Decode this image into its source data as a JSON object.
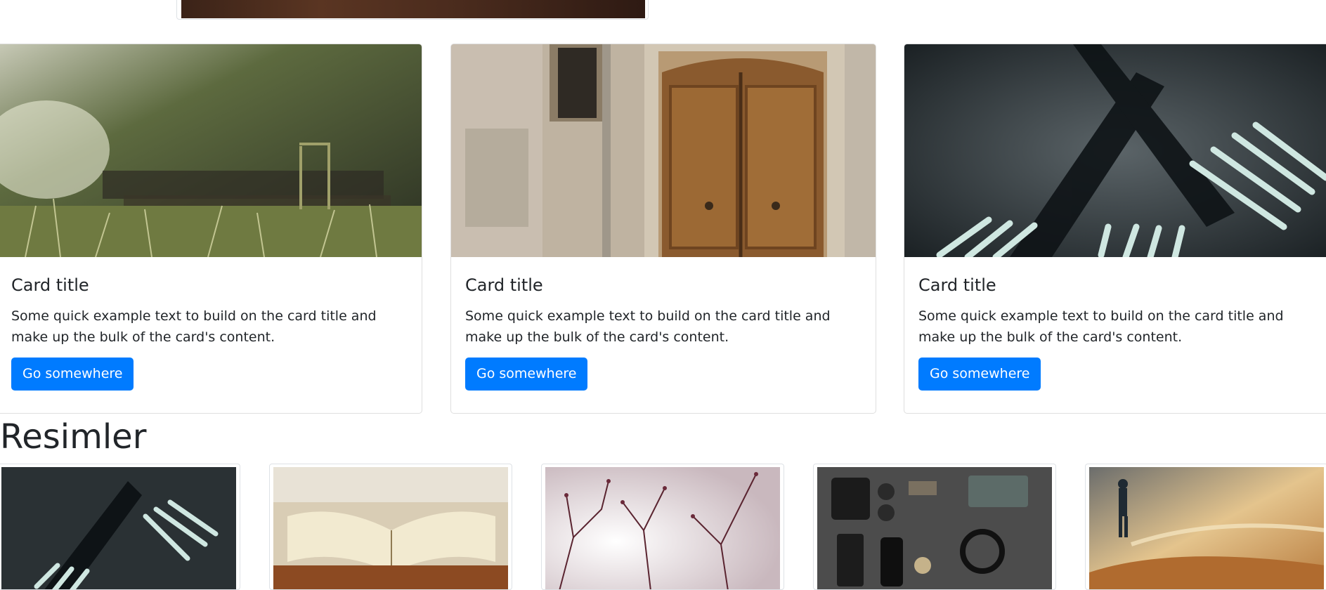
{
  "cards": [
    {
      "image": "grass-steps-photo",
      "title": "Card title",
      "text": "Some quick example text to build on the card title and make up the bulk of the card's content.",
      "button": "Go somewhere"
    },
    {
      "image": "wooden-door-photo",
      "title": "Card title",
      "text": "Some quick example text to build on the card title and make up the bulk of the card's content.",
      "button": "Go somewhere"
    },
    {
      "image": "forks-photo",
      "title": "Card title",
      "text": "Some quick example text to build on the card title and make up the bulk of the card's content.",
      "button": "Go somewhere"
    }
  ],
  "gallery": {
    "heading": "Resimler",
    "images": [
      "forks-photo",
      "open-book-photo",
      "blossom-branches-photo",
      "everyday-items-flatlay-photo",
      "man-by-sea-photo"
    ]
  },
  "colors": {
    "primary": "#007bff",
    "text": "#212529",
    "border": "#dee2e6"
  }
}
